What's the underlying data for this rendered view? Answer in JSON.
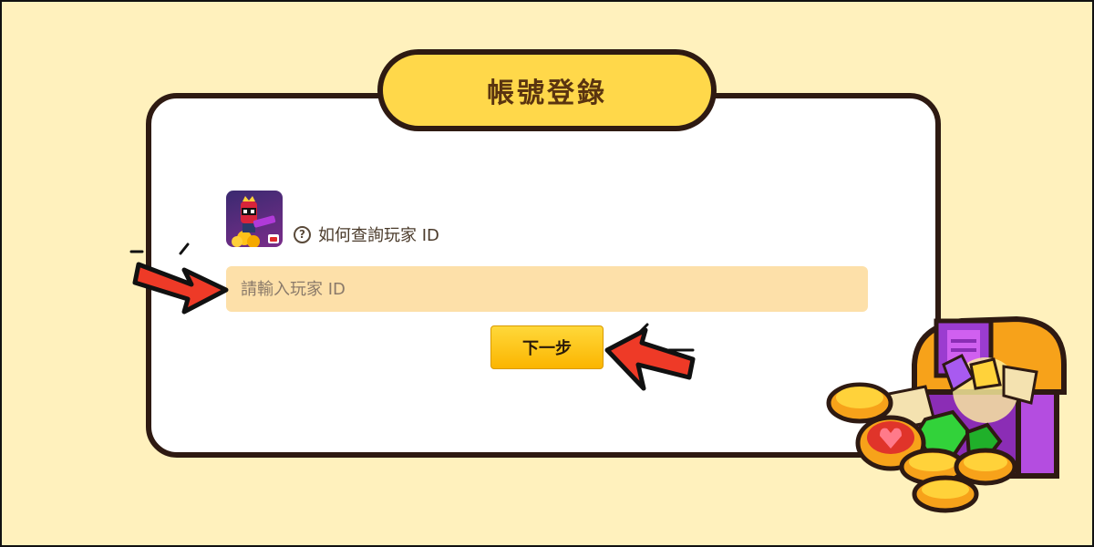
{
  "dialog": {
    "title": "帳號登錄",
    "help_link": "如何查詢玩家 ID",
    "help_icon": "question-circle-icon",
    "input": {
      "placeholder": "請輸入玩家 ID",
      "value": ""
    },
    "next_button": "下一步"
  },
  "colors": {
    "background": "#fff1bd",
    "title_pill": "#ffd84a",
    "input_bg": "#fde0a9",
    "button": "#fbc21a",
    "arrow": "#ee3a27",
    "outline": "#2e1a12"
  }
}
